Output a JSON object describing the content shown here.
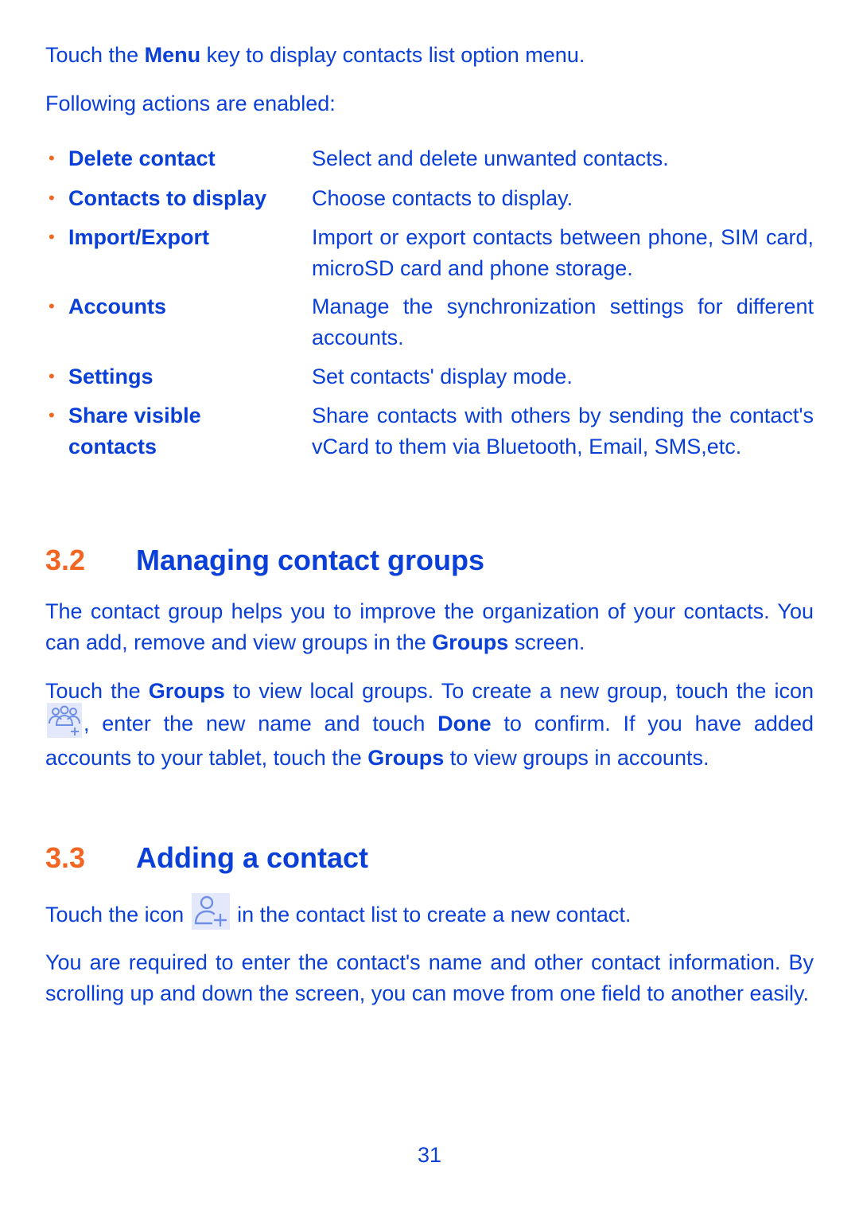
{
  "intro": {
    "line1": {
      "pre": "Touch the ",
      "bold": "Menu",
      "post": " key to display contacts list option menu."
    },
    "line2": "Following actions are enabled:"
  },
  "actions": [
    {
      "term": "Delete contact",
      "desc": "Select and delete unwanted contacts."
    },
    {
      "term": "Contacts to display",
      "desc": "Choose contacts to display."
    },
    {
      "term": "Import/Export",
      "desc": "Import or export contacts between phone, SIM card, microSD card and phone storage."
    },
    {
      "term": "Accounts",
      "desc": "Manage the synchronization settings for different accounts."
    },
    {
      "term": "Settings",
      "desc": "Set contacts' display mode."
    },
    {
      "term": "Share visible contacts",
      "desc": "Share contacts with others by sending the contact's vCard to them via Bluetooth, Email, SMS,etc."
    }
  ],
  "bullet_char": "•",
  "section_32": {
    "number": "3.2",
    "title": "Managing contact groups",
    "para1": {
      "pre": "The contact group helps you to improve the organization of your contacts. You can add, remove and view groups in the ",
      "bold": "Groups",
      "post": " screen."
    },
    "para2": {
      "t1": "Touch the ",
      "b1": "Groups",
      "t2": " to view local groups.  To create a new group, touch the icon ",
      "icon": "add-group-icon",
      "t3": ", enter the new name and touch ",
      "b2": "Done",
      "t4": " to confirm. If you have added accounts to your tablet, touch the ",
      "b3": "Groups",
      "t5": " to view groups in accounts."
    }
  },
  "section_33": {
    "number": "3.3",
    "title": "Adding a contact",
    "para1": {
      "pre": "Touch the icon ",
      "icon": "add-contact-icon",
      "post": " in the contact list to create a new contact."
    },
    "para2": "You are required to enter the contact's name and other contact information. By scrolling up and down the screen, you can move from one field to another easily."
  },
  "page_number": "31",
  "colors": {
    "text": "#0a3fd8",
    "accent": "#f26522",
    "icon_bg": "#e3e9fb"
  }
}
